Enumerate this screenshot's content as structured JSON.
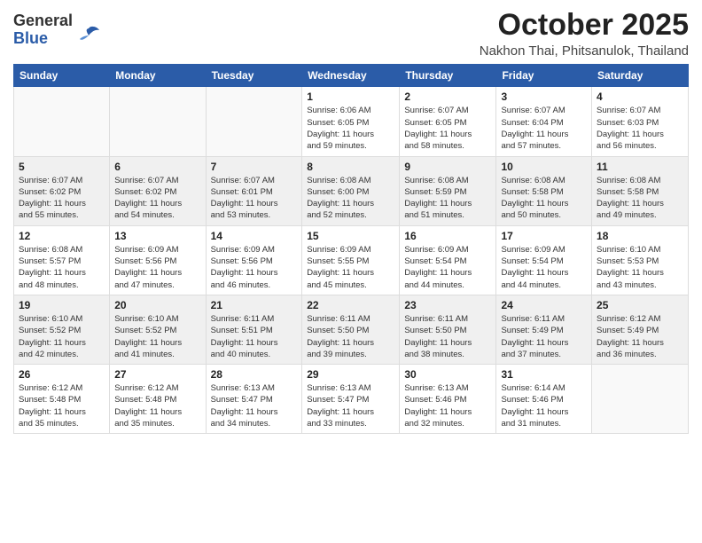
{
  "logo": {
    "general": "General",
    "blue": "Blue"
  },
  "title": {
    "month_year": "October 2025",
    "location": "Nakhon Thai, Phitsanulok, Thailand"
  },
  "weekdays": [
    "Sunday",
    "Monday",
    "Tuesday",
    "Wednesday",
    "Thursday",
    "Friday",
    "Saturday"
  ],
  "weeks": [
    [
      {
        "day": "",
        "info": ""
      },
      {
        "day": "",
        "info": ""
      },
      {
        "day": "",
        "info": ""
      },
      {
        "day": "1",
        "info": "Sunrise: 6:06 AM\nSunset: 6:05 PM\nDaylight: 11 hours\nand 59 minutes."
      },
      {
        "day": "2",
        "info": "Sunrise: 6:07 AM\nSunset: 6:05 PM\nDaylight: 11 hours\nand 58 minutes."
      },
      {
        "day": "3",
        "info": "Sunrise: 6:07 AM\nSunset: 6:04 PM\nDaylight: 11 hours\nand 57 minutes."
      },
      {
        "day": "4",
        "info": "Sunrise: 6:07 AM\nSunset: 6:03 PM\nDaylight: 11 hours\nand 56 minutes."
      }
    ],
    [
      {
        "day": "5",
        "info": "Sunrise: 6:07 AM\nSunset: 6:02 PM\nDaylight: 11 hours\nand 55 minutes."
      },
      {
        "day": "6",
        "info": "Sunrise: 6:07 AM\nSunset: 6:02 PM\nDaylight: 11 hours\nand 54 minutes."
      },
      {
        "day": "7",
        "info": "Sunrise: 6:07 AM\nSunset: 6:01 PM\nDaylight: 11 hours\nand 53 minutes."
      },
      {
        "day": "8",
        "info": "Sunrise: 6:08 AM\nSunset: 6:00 PM\nDaylight: 11 hours\nand 52 minutes."
      },
      {
        "day": "9",
        "info": "Sunrise: 6:08 AM\nSunset: 5:59 PM\nDaylight: 11 hours\nand 51 minutes."
      },
      {
        "day": "10",
        "info": "Sunrise: 6:08 AM\nSunset: 5:58 PM\nDaylight: 11 hours\nand 50 minutes."
      },
      {
        "day": "11",
        "info": "Sunrise: 6:08 AM\nSunset: 5:58 PM\nDaylight: 11 hours\nand 49 minutes."
      }
    ],
    [
      {
        "day": "12",
        "info": "Sunrise: 6:08 AM\nSunset: 5:57 PM\nDaylight: 11 hours\nand 48 minutes."
      },
      {
        "day": "13",
        "info": "Sunrise: 6:09 AM\nSunset: 5:56 PM\nDaylight: 11 hours\nand 47 minutes."
      },
      {
        "day": "14",
        "info": "Sunrise: 6:09 AM\nSunset: 5:56 PM\nDaylight: 11 hours\nand 46 minutes."
      },
      {
        "day": "15",
        "info": "Sunrise: 6:09 AM\nSunset: 5:55 PM\nDaylight: 11 hours\nand 45 minutes."
      },
      {
        "day": "16",
        "info": "Sunrise: 6:09 AM\nSunset: 5:54 PM\nDaylight: 11 hours\nand 44 minutes."
      },
      {
        "day": "17",
        "info": "Sunrise: 6:09 AM\nSunset: 5:54 PM\nDaylight: 11 hours\nand 44 minutes."
      },
      {
        "day": "18",
        "info": "Sunrise: 6:10 AM\nSunset: 5:53 PM\nDaylight: 11 hours\nand 43 minutes."
      }
    ],
    [
      {
        "day": "19",
        "info": "Sunrise: 6:10 AM\nSunset: 5:52 PM\nDaylight: 11 hours\nand 42 minutes."
      },
      {
        "day": "20",
        "info": "Sunrise: 6:10 AM\nSunset: 5:52 PM\nDaylight: 11 hours\nand 41 minutes."
      },
      {
        "day": "21",
        "info": "Sunrise: 6:11 AM\nSunset: 5:51 PM\nDaylight: 11 hours\nand 40 minutes."
      },
      {
        "day": "22",
        "info": "Sunrise: 6:11 AM\nSunset: 5:50 PM\nDaylight: 11 hours\nand 39 minutes."
      },
      {
        "day": "23",
        "info": "Sunrise: 6:11 AM\nSunset: 5:50 PM\nDaylight: 11 hours\nand 38 minutes."
      },
      {
        "day": "24",
        "info": "Sunrise: 6:11 AM\nSunset: 5:49 PM\nDaylight: 11 hours\nand 37 minutes."
      },
      {
        "day": "25",
        "info": "Sunrise: 6:12 AM\nSunset: 5:49 PM\nDaylight: 11 hours\nand 36 minutes."
      }
    ],
    [
      {
        "day": "26",
        "info": "Sunrise: 6:12 AM\nSunset: 5:48 PM\nDaylight: 11 hours\nand 35 minutes."
      },
      {
        "day": "27",
        "info": "Sunrise: 6:12 AM\nSunset: 5:48 PM\nDaylight: 11 hours\nand 35 minutes."
      },
      {
        "day": "28",
        "info": "Sunrise: 6:13 AM\nSunset: 5:47 PM\nDaylight: 11 hours\nand 34 minutes."
      },
      {
        "day": "29",
        "info": "Sunrise: 6:13 AM\nSunset: 5:47 PM\nDaylight: 11 hours\nand 33 minutes."
      },
      {
        "day": "30",
        "info": "Sunrise: 6:13 AM\nSunset: 5:46 PM\nDaylight: 11 hours\nand 32 minutes."
      },
      {
        "day": "31",
        "info": "Sunrise: 6:14 AM\nSunset: 5:46 PM\nDaylight: 11 hours\nand 31 minutes."
      },
      {
        "day": "",
        "info": ""
      }
    ]
  ]
}
